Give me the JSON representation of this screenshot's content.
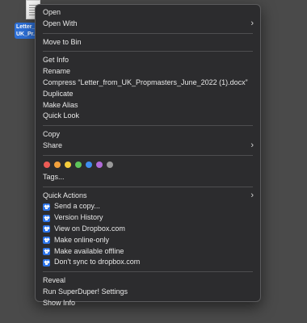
{
  "desktop": {
    "file_label": "Letter_f\nUK_Pr..."
  },
  "menu": {
    "group1": [
      {
        "label": "Open"
      },
      {
        "label": "Open With",
        "submenu": true
      }
    ],
    "group2": [
      {
        "label": "Move to Bin"
      }
    ],
    "group3": [
      {
        "label": "Get Info"
      },
      {
        "label": "Rename"
      },
      {
        "label": "Compress “Letter_from_UK_Propmasters_June_2022 (1).docx”"
      },
      {
        "label": "Duplicate"
      },
      {
        "label": "Make Alias"
      },
      {
        "label": "Quick Look"
      }
    ],
    "group4": [
      {
        "label": "Copy"
      },
      {
        "label": "Share",
        "submenu": true
      }
    ],
    "tag_colors": [
      "#ec5b55",
      "#f2a03c",
      "#f5cd3c",
      "#5dc45a",
      "#3f8ef0",
      "#b06ad8",
      "#9a9a9a"
    ],
    "tags_label": "Tags...",
    "quick_actions_label": "Quick Actions",
    "quick_actions": [
      {
        "label": "Send a copy...",
        "icon": "dropbox-icon"
      },
      {
        "label": "Version History",
        "icon": "dropbox-icon"
      },
      {
        "label": "View on Dropbox.com",
        "icon": "dropbox-icon"
      },
      {
        "label": "Make online-only",
        "icon": "dropbox-icon"
      },
      {
        "label": "Make available offline",
        "icon": "dropbox-icon"
      },
      {
        "label": "Don't sync to dropbox.com",
        "icon": "dropbox-icon"
      }
    ],
    "group6": [
      {
        "label": "Reveal"
      },
      {
        "label": "Run SuperDuper! Settings"
      },
      {
        "label": "Show Info"
      }
    ],
    "chevron_glyph": "›"
  }
}
